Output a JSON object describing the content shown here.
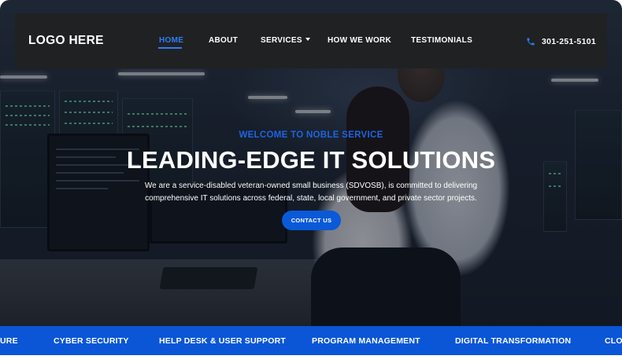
{
  "navbar": {
    "logo": "LOGO HERE",
    "links": [
      {
        "label": "HOME",
        "active": true
      },
      {
        "label": "ABOUT",
        "active": false
      },
      {
        "label": "SERVICES",
        "active": false,
        "dropdown": true
      },
      {
        "label": "HOW WE WORK",
        "active": false
      },
      {
        "label": "TESTIMONIALS",
        "active": false
      }
    ],
    "phone": "301-251-5101",
    "phone_icon": "phone-icon"
  },
  "hero": {
    "subtitle": "WELCOME TO NOBLE SERVICE",
    "title": "LEADING-EDGE IT SOLUTIONS",
    "description_line1": "We are a service-disabled veteran-owned small business (SDVOSB), is committed to delivering",
    "description_line2": "comprehensive IT solutions across federal, state, local government, and private sector projects.",
    "cta_label": "CONTACT US"
  },
  "ticker": {
    "items": [
      "URE",
      "CYBER SECURITY",
      "HELP DESK & USER SUPPORT",
      "PROGRAM MANAGEMENT",
      "DIGITAL TRANSFORMATION",
      "CLO"
    ]
  },
  "colors": {
    "accent": "#0a56d6",
    "nav_active": "#2f7cf6",
    "navbar_bg": "#202123"
  }
}
